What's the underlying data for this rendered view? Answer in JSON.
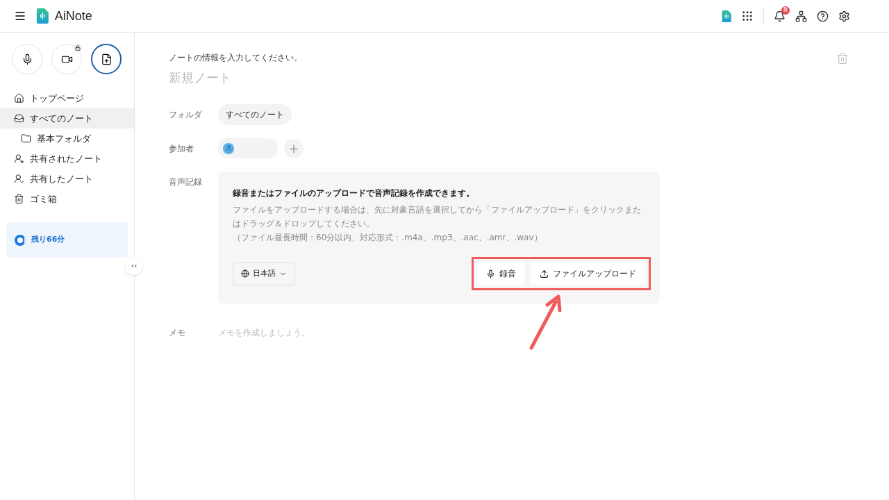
{
  "header": {
    "app_name": "AiNote",
    "notification_badge": "N"
  },
  "sidebar": {
    "quick_actions": [
      {
        "kind": "mic",
        "locked": false,
        "selected": false
      },
      {
        "kind": "video",
        "locked": true,
        "selected": false
      },
      {
        "kind": "note",
        "locked": false,
        "selected": true
      }
    ],
    "items": [
      {
        "kind": "home",
        "label": "トップページ",
        "selected": false
      },
      {
        "kind": "inbox",
        "label": "すべてのノート",
        "selected": true,
        "children": [
          {
            "kind": "folder",
            "label": "基本フォルダ",
            "selected": false
          }
        ]
      },
      {
        "kind": "shared-in",
        "label": "共有されたノート",
        "selected": false
      },
      {
        "kind": "shared-out",
        "label": "共有したノート",
        "selected": false
      },
      {
        "kind": "trash",
        "label": "ゴミ箱",
        "selected": false
      }
    ],
    "quota": {
      "label": "残り66分",
      "level": 0.9
    },
    "collapse_button": "‹‹"
  },
  "note": {
    "prompt": "ノートの情報を入力してください。",
    "title_placeholder": "新規ノート",
    "folder": {
      "label": "フォルダ",
      "value": "すべてのノート"
    },
    "participants": {
      "label": "参加者",
      "add": "+"
    },
    "audio": {
      "label": "音声記録",
      "heading": "録音またはファイルのアップロードで音声記録を作成できます。",
      "description": "ファイルをアップロードする場合は、先に対象言語を選択してから「ファイルアップロード」をクリックまたはドラッグ＆ドロップしてください。",
      "formats": "（ファイル最長時間：60分以内、対応形式：.m4a、.mp3、.aac、.amr、.wav）",
      "language": "日本語",
      "buttons": [
        {
          "kind": "record",
          "label": "録音"
        },
        {
          "kind": "upload",
          "label": "ファイルアップロード"
        }
      ],
      "highlighted": true
    },
    "memo": {
      "label": "メモ",
      "placeholder": "メモを作成しましょう。"
    }
  }
}
